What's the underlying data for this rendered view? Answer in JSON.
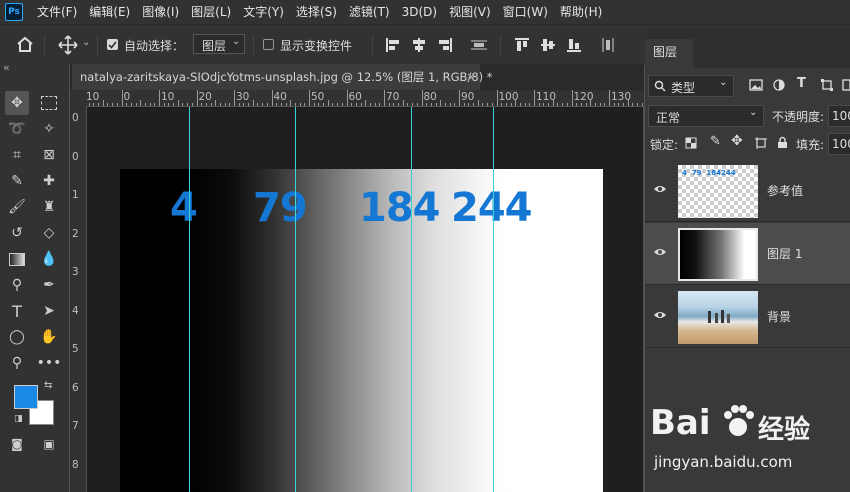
{
  "menubar": {
    "logo": "Ps",
    "items": [
      "文件(F)",
      "编辑(E)",
      "图像(I)",
      "图层(L)",
      "文字(Y)",
      "选择(S)",
      "滤镜(T)",
      "3D(D)",
      "视图(V)",
      "窗口(W)",
      "帮助(H)"
    ]
  },
  "options": {
    "auto_select_label": "自动选择：",
    "auto_select_target": "图层",
    "show_transform_label": "显示变换控件"
  },
  "toolbar": {
    "collapse": "«",
    "foreground_color": "#1b8ae6",
    "background_color": "#ffffff"
  },
  "document": {
    "tab_title": "natalya-zaritskaya-SIOdjcYotms-unsplash.jpg @ 12.5% (图层 1, RGB/8) *",
    "close": "×"
  },
  "ruler_top": [
    "10",
    "0",
    "10",
    "20",
    "30",
    "40",
    "50",
    "60",
    "70",
    "80",
    "90",
    "100",
    "110",
    "120",
    "130",
    "140"
  ],
  "ruler_left": [
    "0",
    "0",
    "1",
    "2",
    "3",
    "4",
    "5",
    "6",
    "7",
    "8"
  ],
  "canvas": {
    "values": [
      "4",
      "79",
      "184",
      "244"
    ],
    "value_color": "#1477d4",
    "guide_color": "#3ad3d8"
  },
  "layers_panel": {
    "tab": "图层",
    "filter_label": "类型",
    "blend_mode": "正常",
    "opacity_label": "不透明度:",
    "opacity_value": "100",
    "lock_label": "锁定:",
    "fill_label": "填充:",
    "fill_value": "100",
    "layers": [
      {
        "name": "参考值",
        "thumb_text": "4  79  184244"
      },
      {
        "name": "图层 1"
      },
      {
        "name": "背景"
      }
    ]
  },
  "watermark": {
    "brand": "Bai",
    "brand2": "经验",
    "url": "jingyan.baidu.com"
  }
}
